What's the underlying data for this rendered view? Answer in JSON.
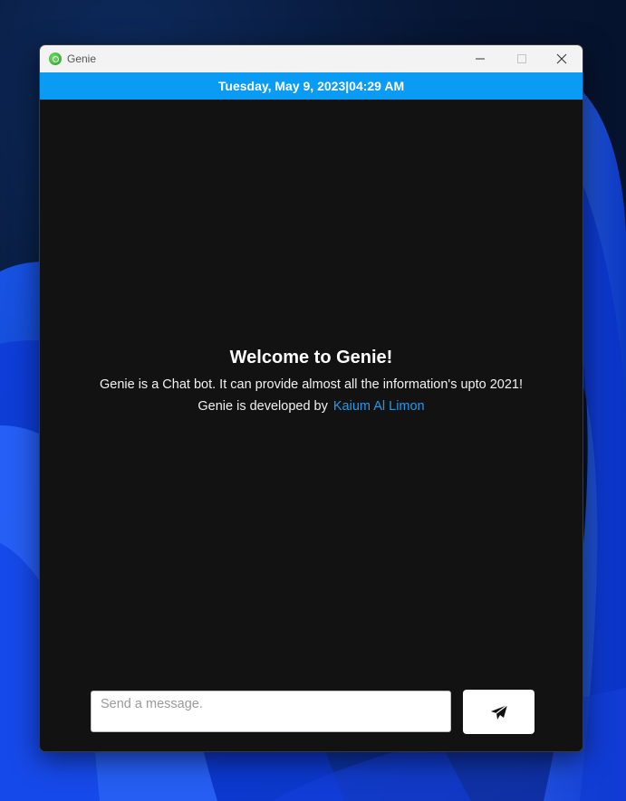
{
  "window": {
    "title": "Genie",
    "app_icon": "genie-app-icon",
    "controls": {
      "minimize_icon": "minimize-icon",
      "maximize_icon": "maximize-icon",
      "close_icon": "close-icon"
    }
  },
  "datebar": {
    "date": "Tuesday, May 9, 2023",
    "separator": "|",
    "time": "04:29 AM",
    "background": "#0a9cf5"
  },
  "welcome": {
    "title": "Welcome to Genie!",
    "description": "Genie is a Chat bot. It can provide almost all the information's upto 2021!",
    "credit_prefix": "Genie is developed by",
    "credit_link": "Kaium Al Limon",
    "link_color": "#1e9bf0"
  },
  "composer": {
    "placeholder": "Send a message.",
    "value": "",
    "send_icon": "paper-plane-icon"
  },
  "colors": {
    "chat_background": "#121212",
    "titlebar": "#f3f3f3"
  }
}
